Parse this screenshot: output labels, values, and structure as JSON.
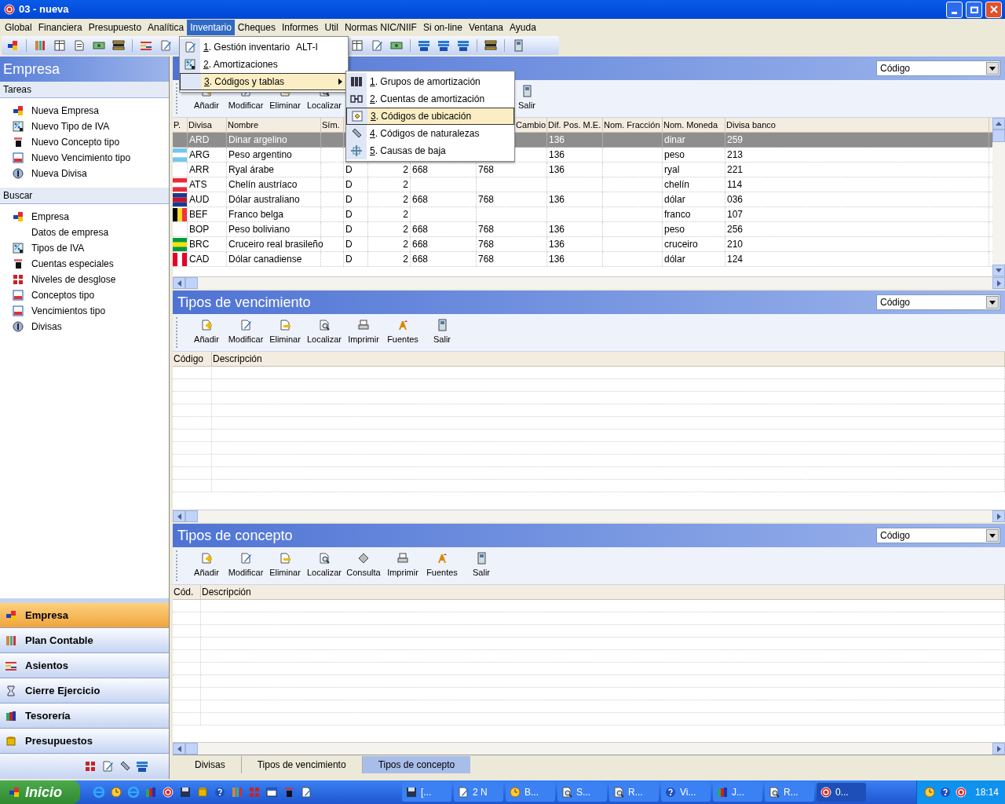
{
  "window": {
    "title": "03 - nueva"
  },
  "menu_bar": [
    {
      "label": "Global",
      "selected": false
    },
    {
      "label": "Financiera",
      "selected": false
    },
    {
      "label": "Presupuesto",
      "selected": false
    },
    {
      "label": "Analítica",
      "selected": false
    },
    {
      "label": "Inventario",
      "selected": true
    },
    {
      "label": "Cheques",
      "selected": false
    },
    {
      "label": "Informes",
      "selected": false
    },
    {
      "label": "Util",
      "selected": false
    },
    {
      "label": "Normas NIC/NIIF",
      "selected": false
    },
    {
      "label": "Si on-line",
      "selected": false
    },
    {
      "label": "Ventana",
      "selected": false
    },
    {
      "label": "Ayuda",
      "selected": false
    }
  ],
  "inventario_menu": [
    {
      "label": "1. Gestión inventario",
      "shortcut": "ALT-I",
      "selected": false,
      "has_submenu": false
    },
    {
      "label": "2. Amortizaciones",
      "selected": false,
      "has_submenu": false
    },
    {
      "label": "3. Códigos y tablas",
      "selected": true,
      "has_submenu": true
    }
  ],
  "submenu": [
    {
      "label": "1. Grupos de amortización",
      "selected": false
    },
    {
      "label": "2. Cuentas de amortización",
      "selected": false
    },
    {
      "label": "3. Códigos de ubicación",
      "selected": true
    },
    {
      "label": "4. Códigos de naturalezas",
      "selected": false
    },
    {
      "label": "5. Causas de baja",
      "selected": false
    }
  ],
  "sidebar": {
    "title": "Empresa",
    "sections": [
      {
        "title": "Tareas",
        "items": [
          "Nueva Empresa",
          "Nuevo Tipo de IVA",
          "Nuevo Concepto tipo",
          "Nuevo Vencimiento tipo",
          "Nueva Divisa"
        ]
      },
      {
        "title": "Buscar",
        "items": [
          "Empresa",
          "Datos de empresa",
          "Tipos de IVA",
          "Cuentas especiales",
          "Niveles de desglose",
          "Conceptos tipo",
          "Vencimientos tipo",
          "Divisas"
        ]
      }
    ],
    "nav": [
      {
        "label": "Empresa",
        "selected": true
      },
      {
        "label": "Plan Contable",
        "selected": false
      },
      {
        "label": "Asientos",
        "selected": false
      },
      {
        "label": "Cierre Ejercicio",
        "selected": false
      },
      {
        "label": "Tesorería",
        "selected": false
      },
      {
        "label": "Presupuestos",
        "selected": false
      }
    ]
  },
  "panels": [
    {
      "sort": "Código",
      "tools": [
        "Añadir",
        "Modificar",
        "Eliminar",
        "Localizar",
        "Salir"
      ],
      "table": {
        "columns": [
          "P.",
          "Divisa",
          "Nombre",
          "Sím.",
          null,
          null,
          null,
          "Cambio",
          "Dif. Pos. M.E.",
          "Nom. Fracción",
          "Nom. Moneda",
          "Divisa banco"
        ],
        "rows": [
          {
            "selected": true,
            "cells": [
              null,
              "ARD",
              "Dinar argelino",
              null,
              null,
              null,
              null,
              null,
              "136",
              null,
              "dinar",
              "259"
            ]
          },
          {
            "selected": false,
            "cells": [
              null,
              "ARG",
              "Peso argentino",
              null,
              null,
              null,
              null,
              null,
              "136",
              null,
              "peso",
              "213"
            ]
          },
          {
            "selected": false,
            "cells": [
              null,
              "ARR",
              "Ryal árabe",
              null,
              "D",
              "2",
              "668",
              "768",
              "136",
              null,
              "ryal",
              "221"
            ]
          },
          {
            "selected": false,
            "cells": [
              null,
              "ATS",
              "Chelín austríaco",
              null,
              "D",
              "2",
              null,
              null,
              null,
              null,
              "chelín",
              "114"
            ]
          },
          {
            "selected": false,
            "cells": [
              null,
              "AUD",
              "Dólar australiano",
              null,
              "D",
              "2",
              "668",
              "768",
              "136",
              null,
              "dólar",
              "036"
            ]
          },
          {
            "selected": false,
            "cells": [
              null,
              "BEF",
              "Franco belga",
              null,
              "D",
              "2",
              null,
              null,
              null,
              null,
              "franco",
              "107"
            ]
          },
          {
            "selected": false,
            "cells": [
              null,
              "BOP",
              "Peso boliviano",
              null,
              "D",
              "2",
              "668",
              "768",
              "136",
              null,
              "peso",
              "256"
            ]
          },
          {
            "selected": false,
            "cells": [
              null,
              "BRC",
              "Cruceiro real brasileño",
              null,
              "D",
              "2",
              "668",
              "768",
              "136",
              null,
              "cruceiro",
              "210"
            ]
          },
          {
            "selected": false,
            "cells": [
              null,
              "CAD",
              "Dólar canadiense",
              null,
              "D",
              "2",
              "668",
              "768",
              "136",
              null,
              "dólar",
              "124"
            ]
          }
        ]
      }
    },
    {
      "title": "Tipos de vencimiento",
      "sort": "Código",
      "tools": [
        "Añadir",
        "Modificar",
        "Eliminar",
        "Localizar",
        "Imprimir",
        "Fuentes",
        "Salir"
      ],
      "table": {
        "columns": [
          "Código",
          "Descripción"
        ]
      }
    },
    {
      "title": "Tipos de concepto",
      "sort": "Código",
      "tools": [
        "Añadir",
        "Modificar",
        "Eliminar",
        "Localizar",
        "Consulta",
        "Imprimir",
        "Fuentes",
        "Salir"
      ],
      "table": {
        "columns": [
          "Cód.",
          "Descripción"
        ]
      }
    }
  ],
  "tabs": [
    {
      "label": "Divisas",
      "selected": false
    },
    {
      "label": "Tipos de vencimiento",
      "selected": false
    },
    {
      "label": "Tipos de concepto",
      "selected": true
    }
  ],
  "taskbar": {
    "start": "Inicio",
    "tasks": [
      "[...",
      "2 N",
      "B...",
      "S...",
      "R...",
      "Vi...",
      "J...",
      "R...",
      "0..."
    ],
    "clock": "18:14"
  }
}
